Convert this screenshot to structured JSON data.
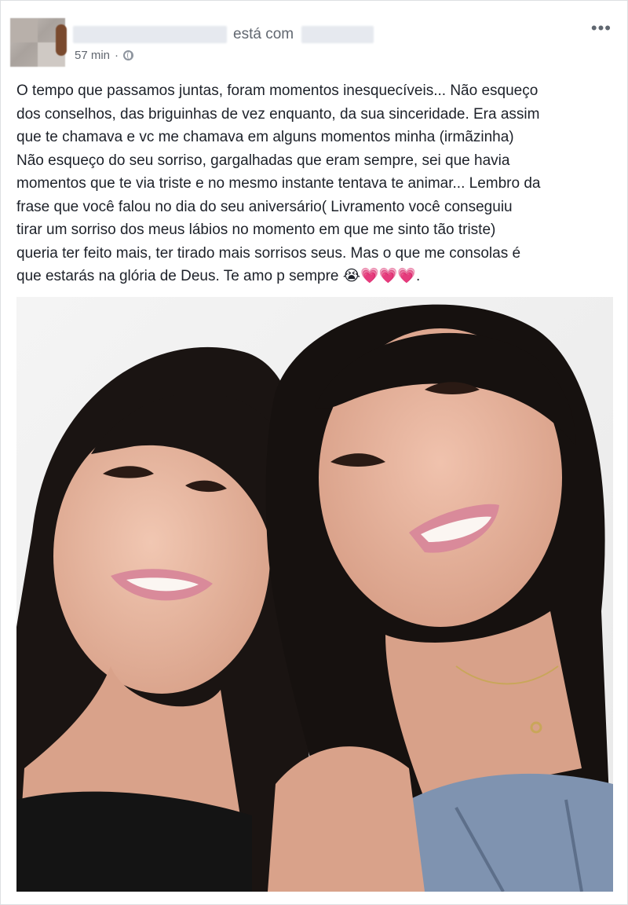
{
  "post": {
    "with_text": "está com",
    "timestamp": "57 min",
    "separator": "·",
    "privacy_icon": "globe-icon",
    "more_icon": "ellipsis-icon",
    "more_label": "•••",
    "body": "O tempo que passamos juntas, foram momentos inesquecíveis... Não esqueço\ndos conselhos, das briguinhas de vez enquanto, da sua sinceridade. Era assim\nque te chamava e vc me chamava em alguns momentos minha (irmãzinha)\nNão esqueço do seu sorriso, gargalhadas que eram sempre, sei que havia\nmomentos que te via triste e no mesmo instante tentava te animar... Lembro da\nfrase que você falou no dia do seu aniversário( Livramento você conseguiu\ntirar um sorriso dos meus lábios no momento em que me sinto tão triste)\nqueria ter feito mais, ter tirado mais sorrisos seus. Mas o que me consolas é\nque estarás na glória de Deus. Te amo p sempre 😭💗💗💗."
  },
  "colors": {
    "text_primary": "#1d2129",
    "text_secondary": "#616770",
    "border": "#dddfe2",
    "hair": "#1a1412",
    "skin": "#e8b9a3",
    "lips": "#d98a9a"
  }
}
